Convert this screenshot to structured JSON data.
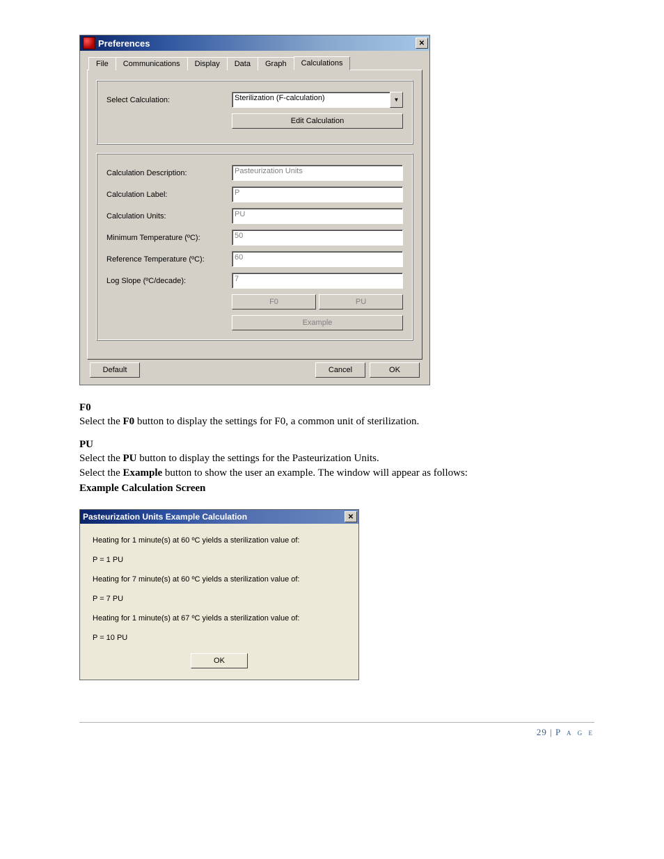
{
  "prefs": {
    "title": "Preferences",
    "tabs": [
      "File",
      "Communications",
      "Display",
      "Data",
      "Graph",
      "Calculations"
    ],
    "activeTab": 5,
    "selectCalcLabel": "Select Calculation:",
    "selectCalcValue": "Sterilization (F-calculation)",
    "editCalcBtn": "Edit Calculation",
    "fields": [
      {
        "label": "Calculation Description:",
        "value": "Pasteurization Units",
        "disabled": true
      },
      {
        "label": "Calculation Label:",
        "value": "P",
        "disabled": true
      },
      {
        "label": "Calculation Units:",
        "value": "PU",
        "disabled": true
      },
      {
        "label": "Minimum Temperature (ºC):",
        "value": "50",
        "disabled": true
      },
      {
        "label": "Reference Temperature (ºC):",
        "value": "60",
        "disabled": true
      },
      {
        "label": "Log Slope (ºC/decade):",
        "value": "7",
        "disabled": true
      }
    ],
    "f0Btn": "F0",
    "puBtn": "PU",
    "exampleBtn": "Example",
    "defaultBtn": "Default",
    "cancelBtn": "Cancel",
    "okBtn": "OK"
  },
  "doc": {
    "h1": "F0",
    "p1a": "Select the ",
    "p1b": "F0",
    "p1c": " button to display the settings for F0, a common unit of sterilization.",
    "h2": "PU",
    "p2a": "Select the ",
    "p2b": "PU",
    "p2c": " button to display the settings for the Pasteurization Units.",
    "p3a": "Select the ",
    "p3b": "Example",
    "p3c": " button to show the user an example. The window will appear as follows:",
    "h3": "Example Calculation Screen"
  },
  "example": {
    "title": "Pasteurization Units Example Calculation",
    "lines": [
      "Heating for 1 minute(s) at 60 ºC yields a sterilization value of:",
      "P = 1 PU",
      "Heating for 7 minute(s) at 60 ºC yields a sterilization value of:",
      "P = 7 PU",
      "Heating for 1 minute(s) at 67 ºC yields a sterilization value of:",
      "P = 10 PU"
    ],
    "okBtn": "OK"
  },
  "footer": {
    "pageNum": "29",
    "sep": " | ",
    "label": "P a g e"
  }
}
